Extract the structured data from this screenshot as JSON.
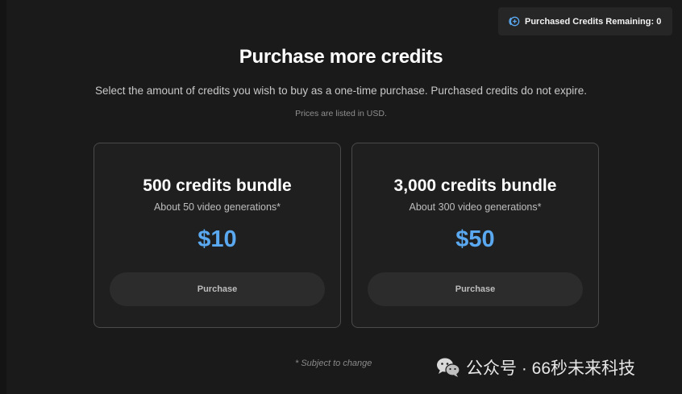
{
  "header": {
    "credits_remaining_label": "Purchased Credits Remaining: 0"
  },
  "main": {
    "title": "Purchase more credits",
    "subtitle": "Select the amount of credits you wish to buy as a one-time purchase. Purchased credits do not expire.",
    "price_note": "Prices are listed in USD."
  },
  "bundles": [
    {
      "title": "500 credits bundle",
      "description": "About 50 video generations*",
      "price": "$10",
      "button_label": "Purchase"
    },
    {
      "title": "3,000 credits bundle",
      "description": "About 300 video generations*",
      "price": "$50",
      "button_label": "Purchase"
    }
  ],
  "footnote": "* Subject to change",
  "watermark": "公众号 · 66秒未来科技",
  "colors": {
    "background": "#1a1a1a",
    "card_border": "#4a4a4a",
    "price_accent": "#5aa9f0",
    "button_bg": "#2c2c2c"
  },
  "icons": {
    "credits": "coin-plus-icon",
    "watermark": "wechat-icon"
  }
}
